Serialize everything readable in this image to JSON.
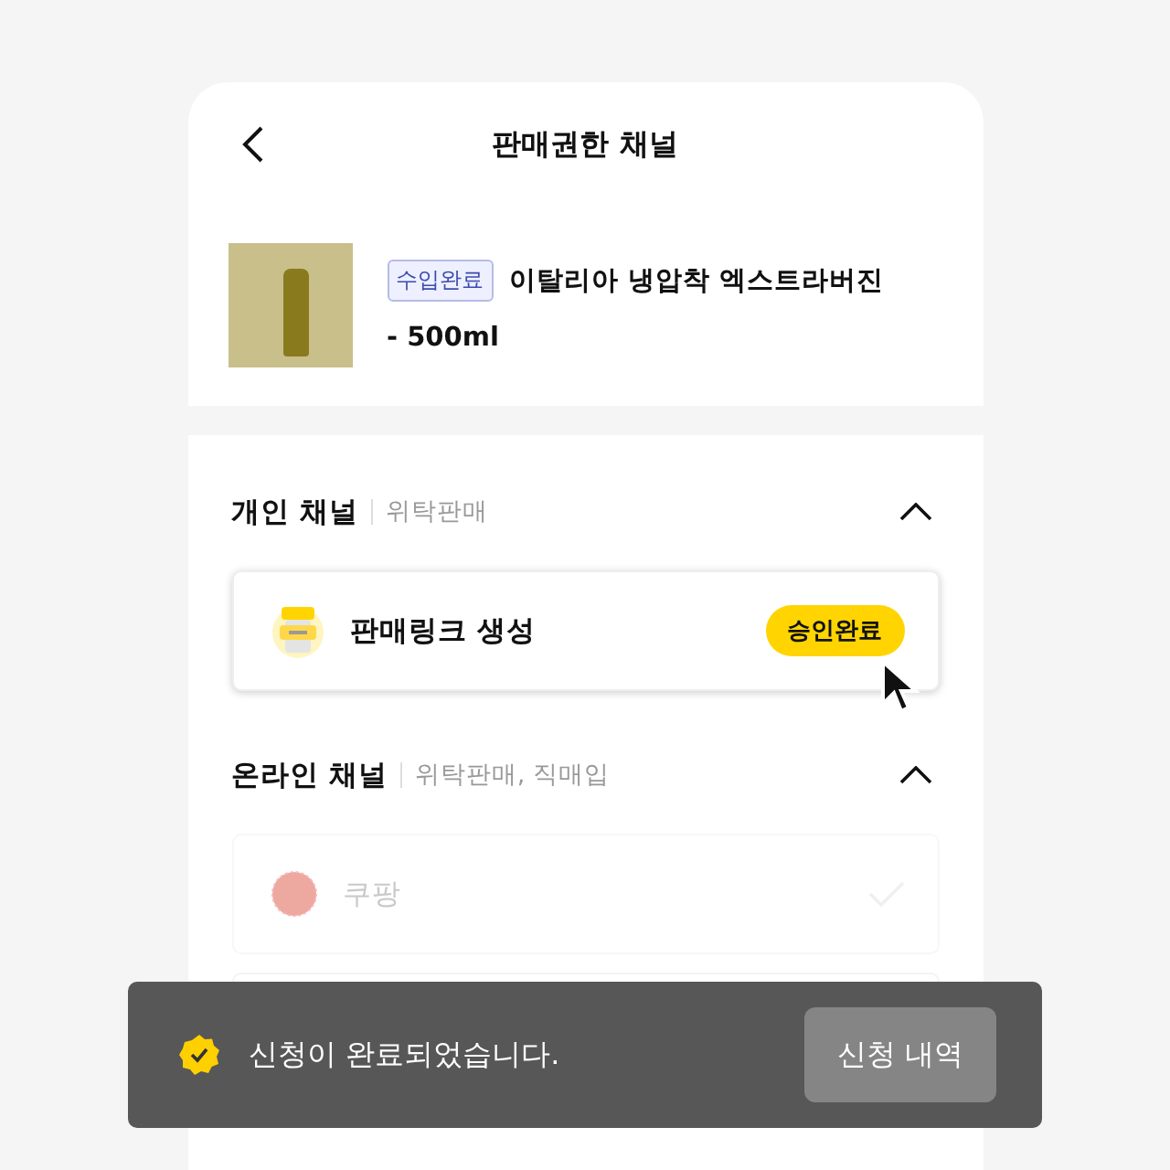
{
  "header": {
    "title": "판매권한 채널"
  },
  "product": {
    "badge": "수입완료",
    "name": "이탈리아 냉압착 엑스트라버진",
    "name_line2": "- 500ml"
  },
  "sections": [
    {
      "title": "개인 채널",
      "subtitle": "위탁판매",
      "expanded": true,
      "items": [
        {
          "kind": "link",
          "label": "판매링크 생성",
          "status": "승인완료",
          "disabled": false
        }
      ]
    },
    {
      "title": "온라인 채널",
      "subtitle": "위탁판매, 직매입",
      "expanded": true,
      "items": [
        {
          "kind": "market",
          "label": "쿠팡",
          "disabled": true
        }
      ]
    }
  ],
  "toast": {
    "message": "신청이 완료되었습니다.",
    "action": "신청 내역"
  }
}
